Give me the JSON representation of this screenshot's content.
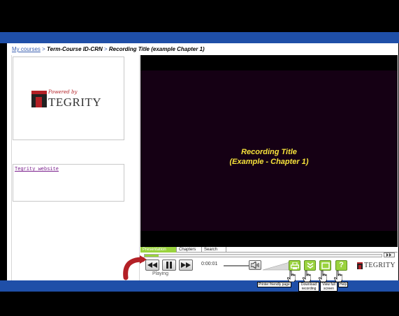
{
  "breadcrumb": {
    "home": "My courses",
    "sep1": ">",
    "course": "Term-Course ID-CRN",
    "sep2": ">",
    "recording": "Recording Title (example Chapter 1)"
  },
  "logo": {
    "powered": "Powered by",
    "brand": "TEGRITY"
  },
  "links": {
    "website": "Tegrity website"
  },
  "video": {
    "title_line1": "Recording Title",
    "title_line2": "(Example - Chapter 1)"
  },
  "tabs": [
    "Presentation",
    "Chapters",
    "Search"
  ],
  "player": {
    "time": "0:00:01",
    "status": "Playing",
    "progress": 0.06
  },
  "tooltips": {
    "print": "Printer friendly page",
    "download": "Download recording",
    "fullscreen": "View full screen",
    "help": "Help"
  },
  "icons": {
    "rewind": "rewind-icon",
    "pause": "pause-icon",
    "forward": "fast-forward-icon",
    "speaker": "speaker-icon",
    "print": "printer-icon",
    "download": "download-icon",
    "fullscreen": "fullscreen-icon",
    "help": "help-icon",
    "pointer": "hand-pointer-icon"
  },
  "colors": {
    "blue": "#1f4fa8",
    "green": "#9ad33e",
    "title": "#f6e23b",
    "arrow": "#b32026"
  }
}
